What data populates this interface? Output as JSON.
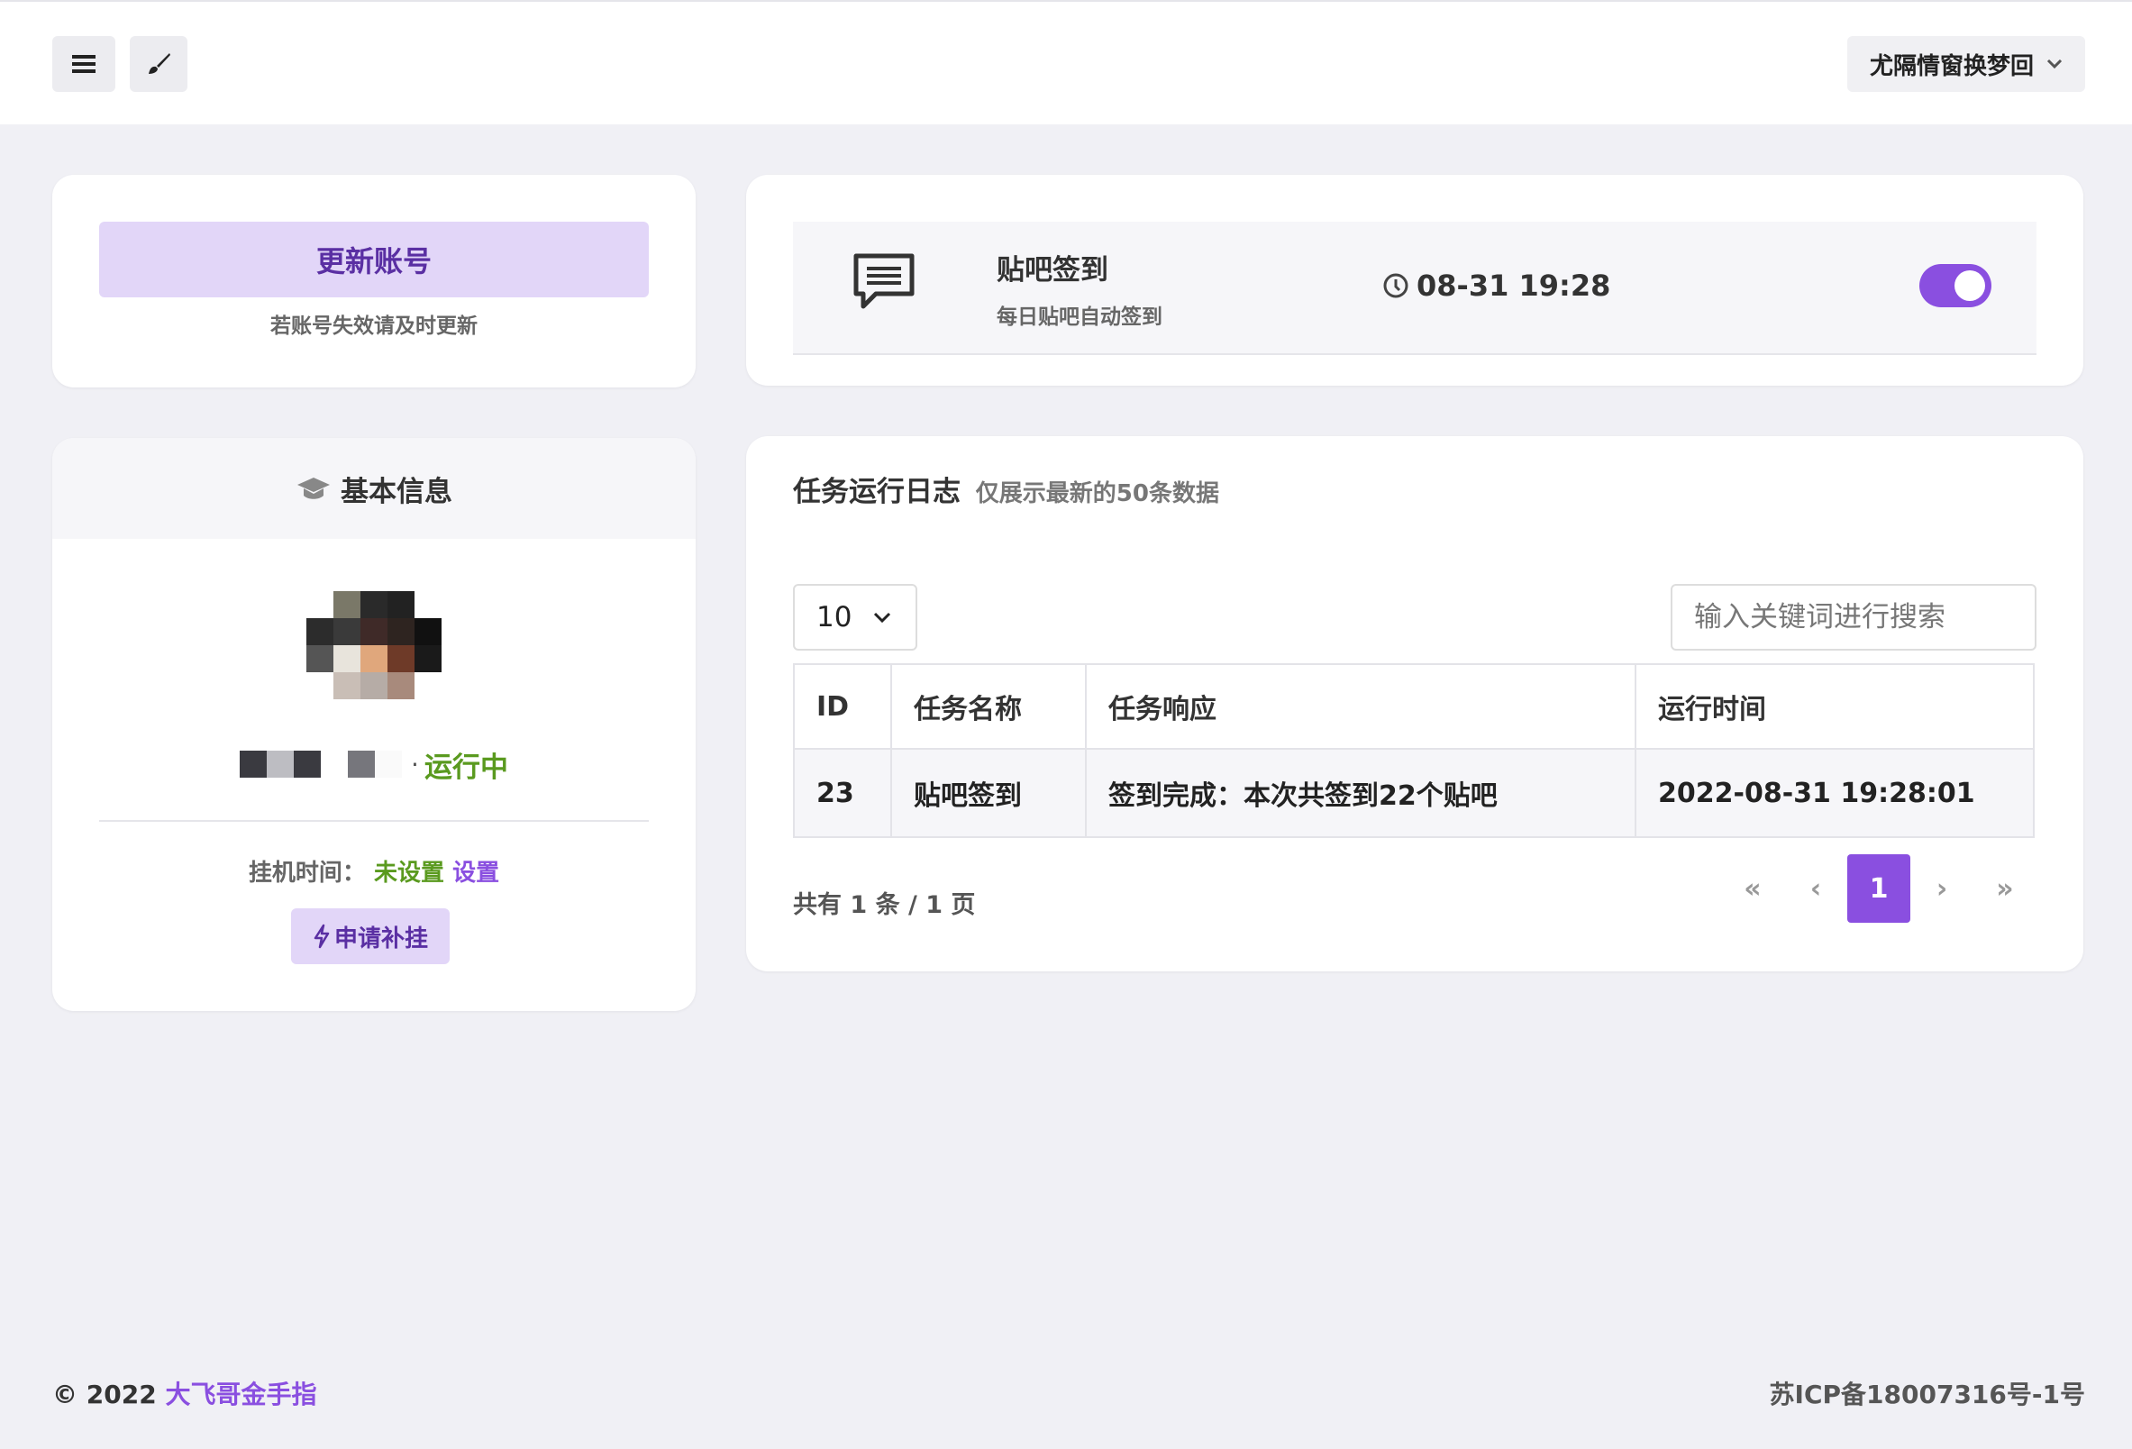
{
  "header": {
    "menu_icon": "hamburger-menu-icon",
    "theme_icon": "paint-brush-icon",
    "username": "尤隔情窗换梦回",
    "dropdown_icon": "chevron-down-icon"
  },
  "account_card": {
    "update_button": "更新账号",
    "note": "若账号失效请及时更新"
  },
  "task_card": {
    "icon": "chat-message-icon",
    "title": "贴吧签到",
    "subtitle": "每日贴吧自动签到",
    "clock_icon": "clock-icon",
    "time": "08-31 19:28",
    "enabled": true,
    "accent": "#8a4fe0"
  },
  "info_card": {
    "title": "基本信息",
    "title_icon": "graduation-cap-icon",
    "status_separator": "·",
    "status": "运行中",
    "hang_label": "挂机时间：",
    "hang_value": "未设置",
    "hang_link": "设置",
    "apply_button": "申请补挂",
    "apply_icon": "lightning-icon"
  },
  "log_card": {
    "title": "任务运行日志",
    "subtitle": "仅展示最新的50条数据",
    "page_size": "10",
    "search_placeholder": "输入关键词进行搜索",
    "columns": [
      "ID",
      "任务名称",
      "任务响应",
      "运行时间"
    ],
    "rows": [
      {
        "id": "23",
        "name": "贴吧签到",
        "response": "签到完成：本次共签到22个贴吧",
        "time": "2022-08-31 19:28:01"
      }
    ],
    "total": "共有 1 条 / 1 页",
    "pager": {
      "first": "«",
      "prev": "‹",
      "current": "1",
      "next": "›",
      "last": "»"
    }
  },
  "footer": {
    "copyright": "© 2022 ",
    "brand": "大飞哥金手指",
    "icp": "苏ICP备18007316号-1号"
  },
  "colors": {
    "accent": "#8a4fe0",
    "accent_light": "#e2d6f8",
    "running_green": "#5a9a1f",
    "background": "#f0f0f5"
  }
}
